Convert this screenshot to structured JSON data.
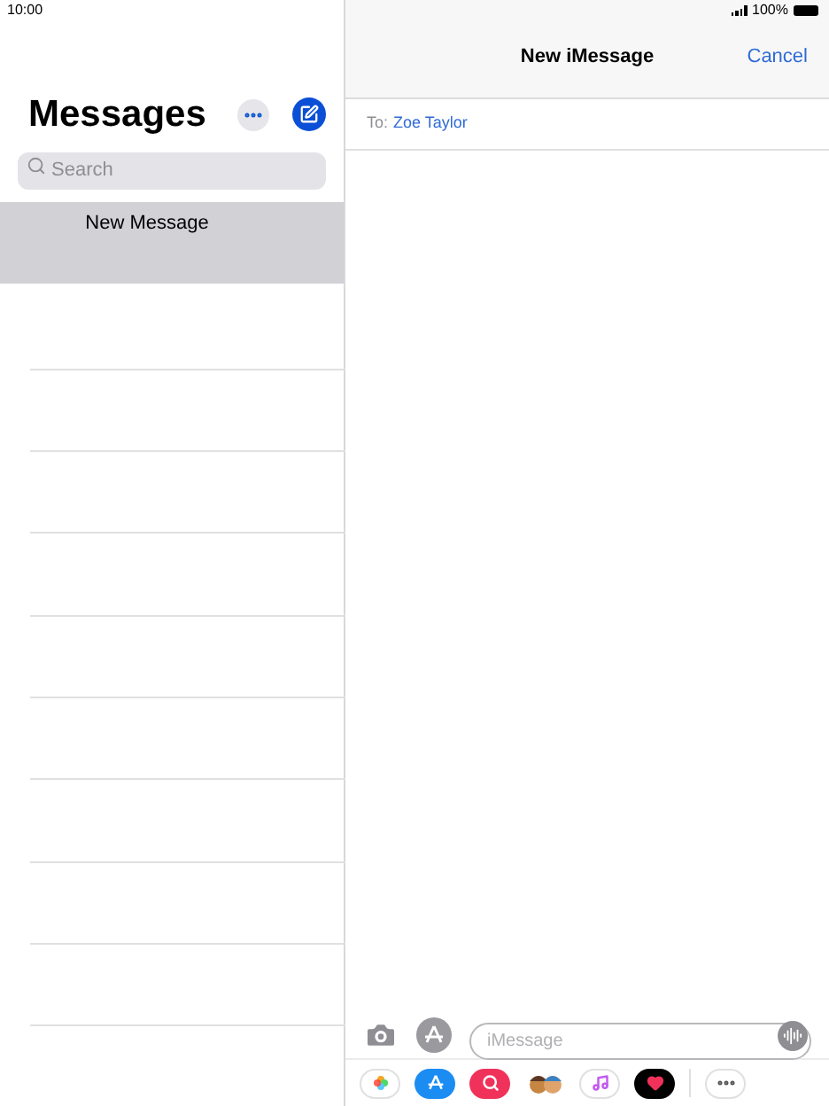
{
  "status_bar": {
    "time": "10:00",
    "battery": "100%"
  },
  "sidebar": {
    "title": "Messages",
    "search": {
      "placeholder": "Search"
    },
    "items": [
      {
        "title": "New Message",
        "selected": true
      }
    ]
  },
  "compose": {
    "title": "New iMessage",
    "cancel": "Cancel",
    "to_label": "To:",
    "recipient": "Zoe Taylor",
    "message_field": {
      "placeholder": "iMessage"
    }
  }
}
